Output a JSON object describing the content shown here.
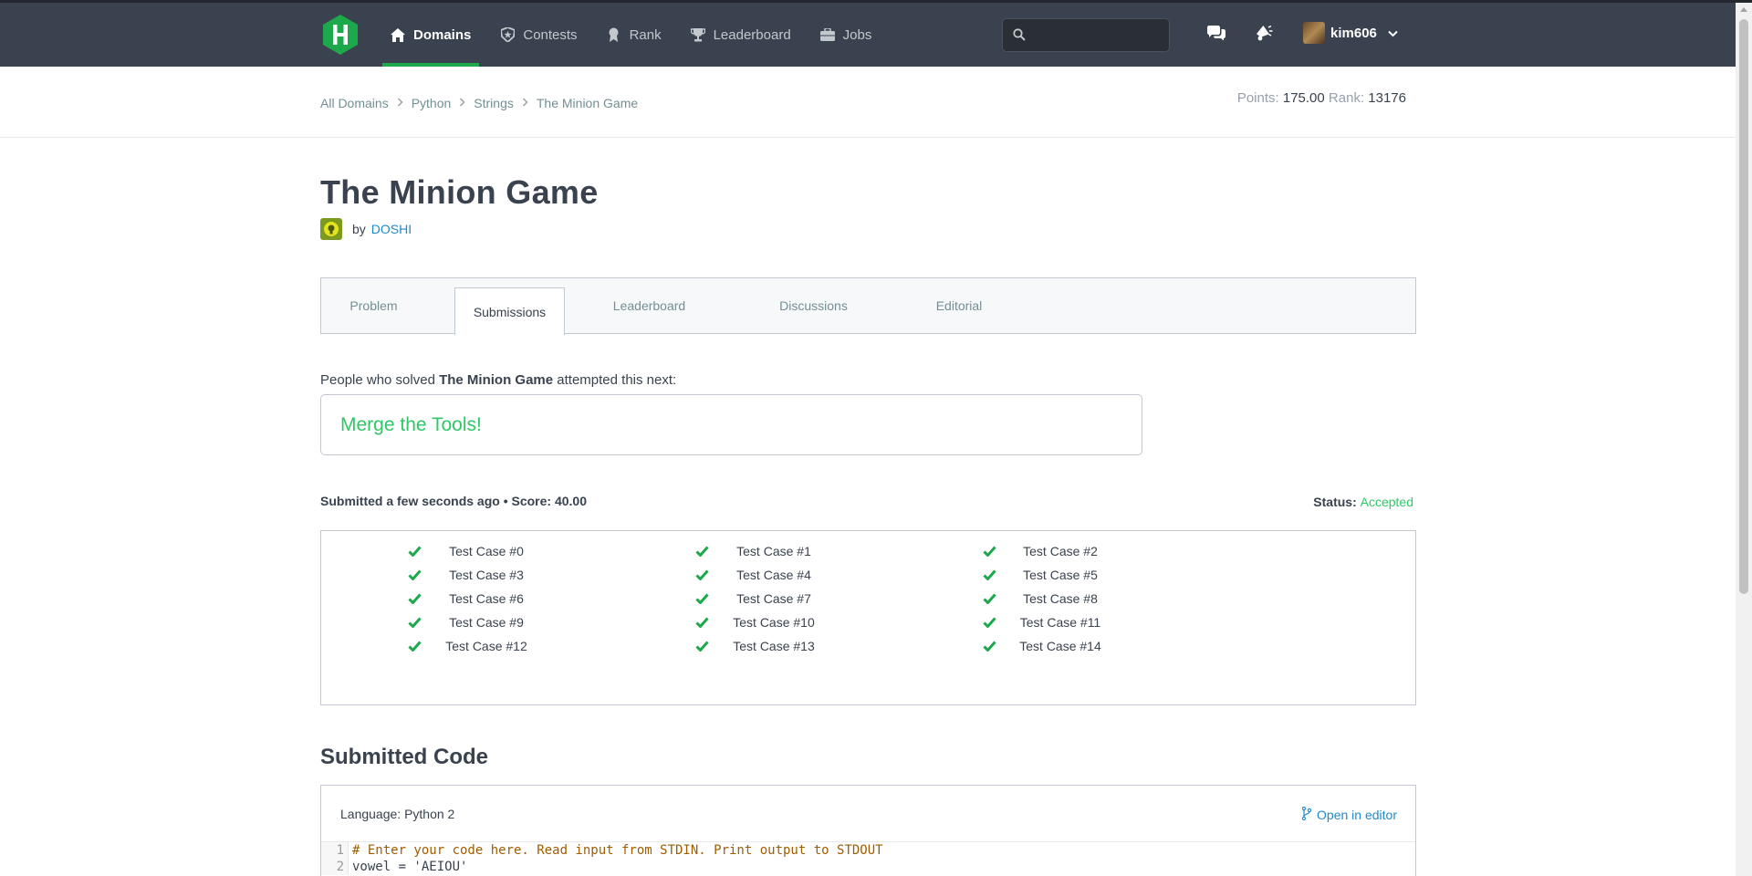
{
  "nav": {
    "items": [
      {
        "label": "Domains",
        "icon": "home-icon",
        "active": true
      },
      {
        "label": "Contests",
        "icon": "shield-icon",
        "active": false
      },
      {
        "label": "Rank",
        "icon": "medal-icon",
        "active": false
      },
      {
        "label": "Leaderboard",
        "icon": "trophy-icon",
        "active": false
      },
      {
        "label": "Jobs",
        "icon": "briefcase-icon",
        "active": false
      }
    ],
    "search_placeholder": "",
    "username": "kim606"
  },
  "breadcrumb": [
    "All Domains",
    "Python",
    "Strings",
    "The Minion Game"
  ],
  "stats": {
    "points_label": "Points:",
    "points": "175.00",
    "rank_label": "Rank:",
    "rank": "13176"
  },
  "challenge": {
    "title": "The Minion Game",
    "by": "by",
    "author": "DOSHI"
  },
  "tabs": [
    "Problem",
    "Submissions",
    "Leaderboard",
    "Discussions",
    "Editorial"
  ],
  "next": {
    "prefix": "People who solved ",
    "challenge": "The Minion Game",
    "suffix": " attempted this next:",
    "suggestion": "Merge the Tools!"
  },
  "submission": {
    "summary": "Submitted a few seconds ago • Score: 40.00",
    "status_label": "Status: ",
    "status": "Accepted",
    "accent": "#2ec866"
  },
  "test_cases": [
    "Test Case #0",
    "Test Case #1",
    "Test Case #2",
    "Test Case #3",
    "Test Case #4",
    "Test Case #5",
    "Test Case #6",
    "Test Case #7",
    "Test Case #8",
    "Test Case #9",
    "Test Case #10",
    "Test Case #11",
    "Test Case #12",
    "Test Case #13",
    "Test Case #14"
  ],
  "code": {
    "heading": "Submitted Code",
    "language": "Language: Python 2",
    "open_editor": "Open in editor",
    "lines": [
      {
        "n": "1",
        "text": "# Enter your code here. Read input from STDIN. Print output to STDOUT"
      },
      {
        "n": "2",
        "text": "vowel = 'AEIOU'"
      }
    ]
  }
}
